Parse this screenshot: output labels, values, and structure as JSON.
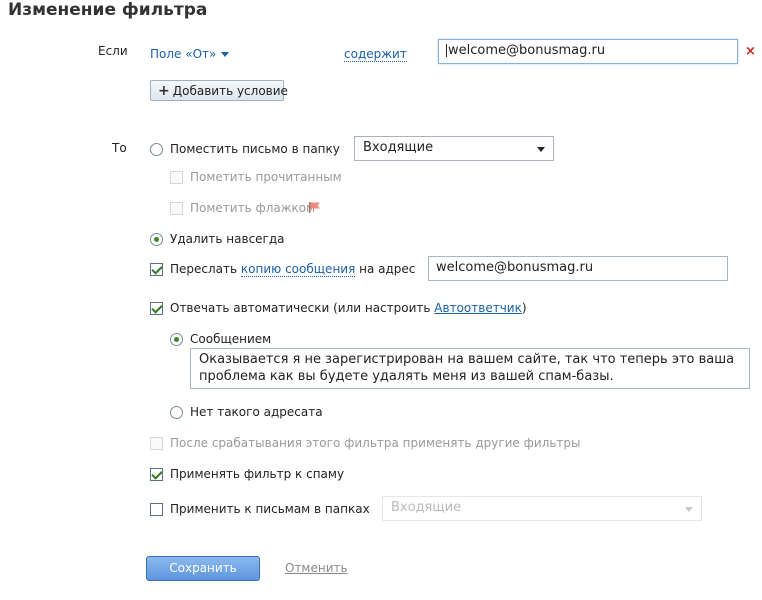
{
  "title": "Изменение фильтра",
  "condition": {
    "if_label": "Если",
    "field_label": "Поле «От»",
    "operator_label": "содержит",
    "value": "welcome@bonusmag.ru",
    "add_condition_label": "Добавить условие"
  },
  "actions": {
    "then_label": "То",
    "move_to_folder_label": "Поместить письмо в папку",
    "folder_select_value": "Входящие",
    "mark_read_label": "Пометить прочитанным",
    "mark_flag_label": "Пометить флажком",
    "delete_forever_label": "Удалить навсегда",
    "forward_prefix": "Переслать",
    "forward_link": "копию сообщения",
    "forward_suffix": "на адрес",
    "forward_address": "welcome@bonusmag.ru",
    "autoreply_prefix": "Отвечать автоматически (или настроить",
    "autoreply_link": "Автоответчик",
    "autoreply_suffix": ")",
    "reply_message_label": "Сообщением",
    "reply_message_text": "Оказывается я не зарегистрирован на вашем сайте, так что теперь это ваша проблема как вы будете удалять меня из вашей спам-базы.",
    "no_such_address_label": "Нет такого адресата",
    "apply_other_filters_label": "После срабатывания этого фильтра применять другие фильтры",
    "apply_to_spam_label": "Применять фильтр к спаму",
    "apply_to_folders_label": "Применить к письмам в папках",
    "folders_select_value": "Входящие"
  },
  "footer": {
    "save_label": "Сохранить",
    "cancel_label": "Отменить"
  },
  "colors": {
    "link": "#1a5fa8",
    "save_button": "#5d95dd",
    "delete_x": "#cc2222"
  }
}
